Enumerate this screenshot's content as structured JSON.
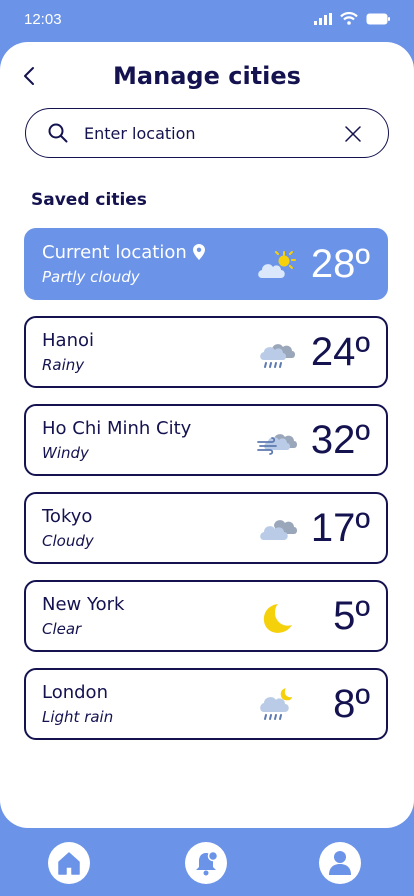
{
  "status": {
    "time": "12:03"
  },
  "header": {
    "title": "Manage cities"
  },
  "search": {
    "placeholder": "Enter location"
  },
  "saved": {
    "title": "Saved cities"
  },
  "cities": [
    {
      "name": "Current location",
      "condition": "Partly cloudy",
      "temp": "28º",
      "icon": "partly-cloudy-icon"
    },
    {
      "name": "Hanoi",
      "condition": "Rainy",
      "temp": "24º",
      "icon": "rain-icon"
    },
    {
      "name": "Ho Chi Minh City",
      "condition": "Windy",
      "temp": "32º",
      "icon": "wind-icon"
    },
    {
      "name": "Tokyo",
      "condition": "Cloudy",
      "temp": "17º",
      "icon": "cloud-icon"
    },
    {
      "name": "New York",
      "condition": "Clear",
      "temp": "5º",
      "icon": "moon-icon"
    },
    {
      "name": "London",
      "condition": "Light rain",
      "temp": "8º",
      "icon": "night-rain-icon"
    }
  ],
  "colors": {
    "accent": "#6b93e8",
    "navy": "#14124f",
    "sun": "#f5d10c"
  },
  "nav": [
    "home-icon",
    "notification-icon",
    "profile-icon"
  ]
}
